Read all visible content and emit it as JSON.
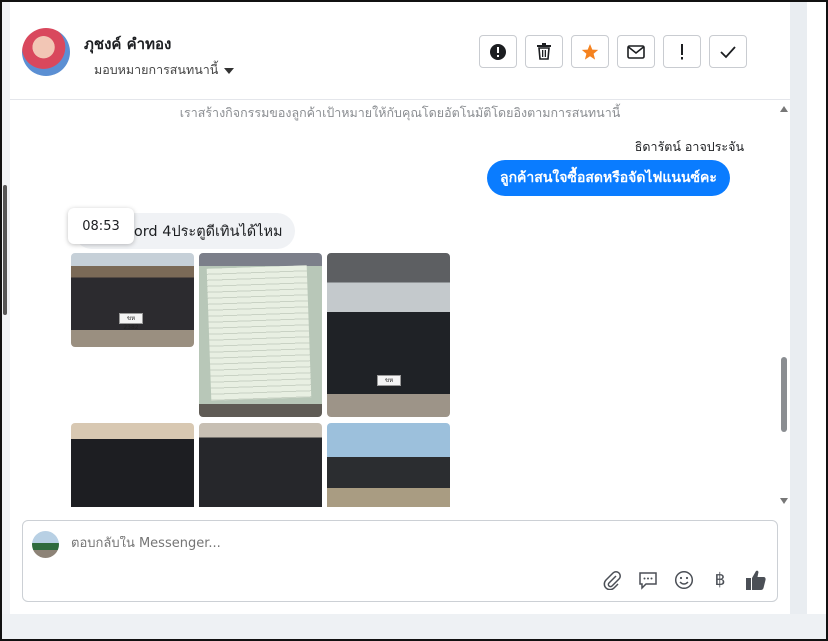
{
  "contact": {
    "name": "ภุชงค์ คำทอง",
    "assign_label": "มอบหมายการสนทนานี้"
  },
  "header_actions": [
    {
      "icon": "alert-circle-icon"
    },
    {
      "icon": "trash-icon"
    },
    {
      "icon": "star-icon",
      "color": "#f5821f"
    },
    {
      "icon": "envelope-icon"
    },
    {
      "icon": "exclamation-icon"
    },
    {
      "icon": "check-icon"
    }
  ],
  "conversation": {
    "notice": "เราสร้างกิจกรรมของลูกค้าเป้าหมายให้กับคุณโดยอัตโนมัติโดยอิงตามการสนทนานี้",
    "outgoing_sender": "ธิดารัตน์ อาจประจัน",
    "outgoing_message": "ลูกค้าสนใจซื้อสดหรือจัดไฟแนนซ์คะ",
    "incoming_message": "Ford 4ประตูดีเทินได้ไหม",
    "timestamp_tooltip": "08:53",
    "photo_plates": [
      "ขห 2382",
      "ขห 2382"
    ]
  },
  "composer": {
    "placeholder": "ตอบกลับใน Messenger...",
    "tools": [
      "paperclip-icon",
      "chat-icon",
      "smiley-icon",
      "baht-icon",
      "thumbs-up-icon"
    ],
    "baht_symbol": "฿"
  },
  "colors": {
    "accent": "#0a7cff",
    "bubble_gray": "#f0f2f5",
    "star": "#f5821f"
  }
}
